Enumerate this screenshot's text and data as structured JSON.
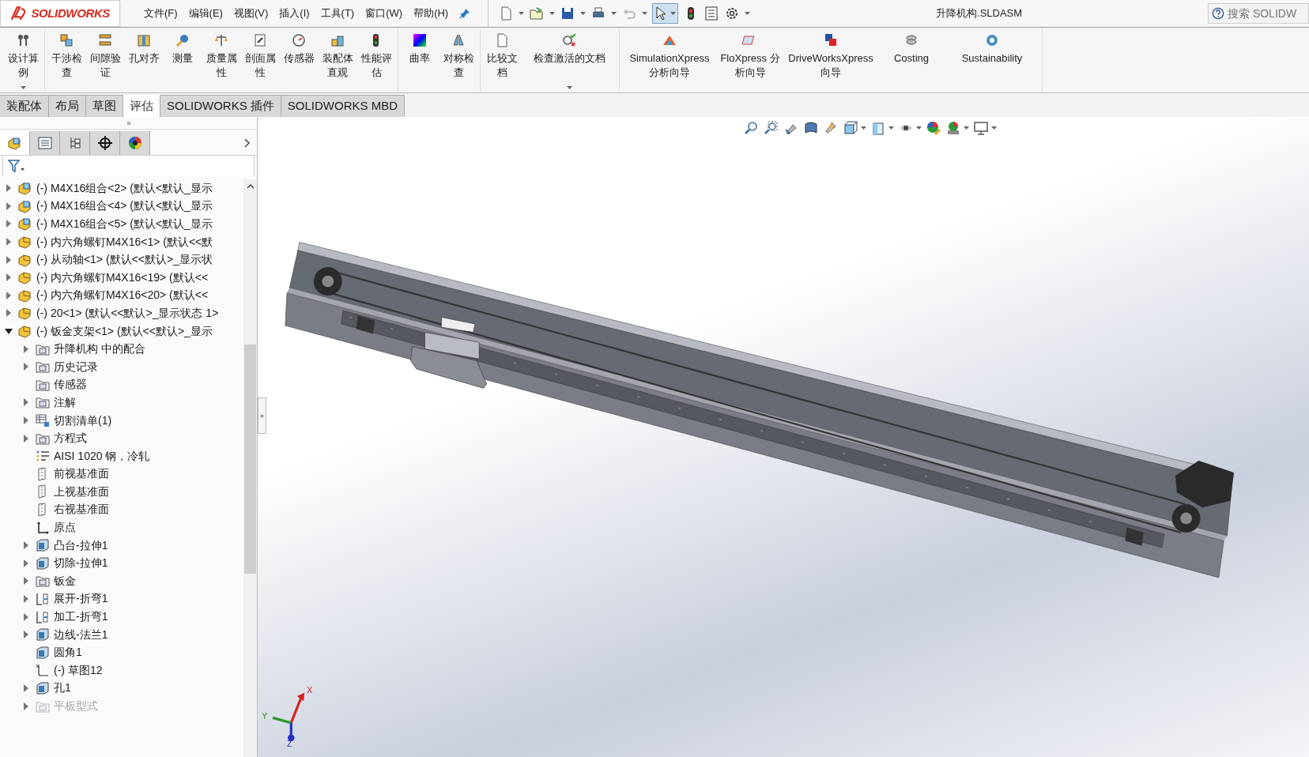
{
  "app": {
    "logo": "SOLIDWORKS"
  },
  "menu": [
    "文件(F)",
    "编辑(E)",
    "视图(V)",
    "插入(I)",
    "工具(T)",
    "窗口(W)",
    "帮助(H)"
  ],
  "window": {
    "title": "升降机构.SLDASM"
  },
  "search": {
    "placeholder": "搜索 SOLIDW"
  },
  "ribbon": {
    "groups": [
      [
        {
          "label": "设计算例",
          "kind": "narrow",
          "has_menu": true
        }
      ],
      [
        {
          "label": "干涉检查",
          "kind": "narrow",
          "has_menu": false
        },
        {
          "label": "间隙验证",
          "kind": "narrow",
          "has_menu": false
        },
        {
          "label": "孔对齐",
          "kind": "narrow",
          "has_menu": false
        },
        {
          "label": "测量",
          "kind": "narrow",
          "has_menu": false
        },
        {
          "label": "质量属性",
          "kind": "narrow",
          "has_menu": false
        },
        {
          "label": "剖面属性",
          "kind": "narrow",
          "has_menu": false
        },
        {
          "label": "传感器",
          "kind": "narrow",
          "has_menu": false
        },
        {
          "label": "装配体直观",
          "kind": "narrow",
          "has_menu": false
        },
        {
          "label": "性能评估",
          "kind": "narrow",
          "has_menu": false
        }
      ],
      [
        {
          "label": "曲率",
          "kind": "narrow",
          "has_menu": false
        },
        {
          "label": "对称检查",
          "kind": "narrow",
          "has_menu": false
        }
      ],
      [
        {
          "label": "比较文档",
          "kind": "narrow",
          "has_menu": false
        },
        {
          "label": "检查激活的文档",
          "kind": "wide",
          "has_menu": true
        }
      ],
      [
        {
          "label": "SimulationXpress 分析向导",
          "kind": "wide",
          "has_menu": false
        },
        {
          "label": "FloXpress 分析向导",
          "kind": "medium",
          "has_menu": false
        },
        {
          "label": "DriveWorksXpress 向导",
          "kind": "wide",
          "has_menu": false
        },
        {
          "label": "Costing",
          "kind": "medium",
          "has_menu": false
        },
        {
          "label": "Sustainability",
          "kind": "wide",
          "has_menu": false
        }
      ]
    ]
  },
  "tabs": [
    {
      "label": "装配体",
      "selected": false
    },
    {
      "label": "布局",
      "selected": false
    },
    {
      "label": "草图",
      "selected": false
    },
    {
      "label": "评估",
      "selected": true
    },
    {
      "label": "SOLIDWORKS 插件",
      "selected": false
    },
    {
      "label": "SOLIDWORKS MBD",
      "selected": false
    }
  ],
  "feature_manager": {
    "panel_tabs": [
      {
        "selected": true
      },
      {
        "selected": false
      },
      {
        "selected": false
      },
      {
        "selected": false
      },
      {
        "selected": false
      }
    ],
    "tree": [
      {
        "label": "(-) M4X16组合<2> (默认<默认_显示",
        "kind": "assembly",
        "expanded": false,
        "disabled": false
      },
      {
        "label": "(-) M4X16组合<4> (默认<默认_显示",
        "kind": "assembly",
        "expanded": false,
        "disabled": false
      },
      {
        "label": "(-) M4X16组合<5> (默认<默认_显示",
        "kind": "assembly",
        "expanded": false,
        "disabled": false
      },
      {
        "label": "(-) 内六角螺钉M4X16<1> (默认<<默",
        "kind": "part",
        "expanded": false,
        "disabled": false
      },
      {
        "label": "(-) 从动轴<1> (默认<<默认>_显示状",
        "kind": "part",
        "expanded": false,
        "disabled": false
      },
      {
        "label": "(-) 内六角螺钉M4X16<19> (默认<<",
        "kind": "part",
        "expanded": false,
        "disabled": false
      },
      {
        "label": "(-) 内六角螺钉M4X16<20> (默认<<",
        "kind": "part",
        "expanded": false,
        "disabled": false
      },
      {
        "label": "(-) 20<1> (默认<<默认>_显示状态 1>",
        "kind": "part",
        "expanded": false,
        "disabled": false
      },
      {
        "label": "(-) 钣金支架<1> (默认<<默认>_显示",
        "kind": "part",
        "expanded": true,
        "disabled": false,
        "children": [
          {
            "label": "升降机构 中的配合",
            "kind": "folder",
            "expanded": false,
            "disabled": false
          },
          {
            "label": "历史记录",
            "kind": "folder",
            "expanded": false,
            "disabled": false
          },
          {
            "label": "传感器",
            "kind": "folder",
            "disabled": false
          },
          {
            "label": "注解",
            "kind": "folder",
            "expanded": false,
            "disabled": false
          },
          {
            "label": "切割清单(1)",
            "kind": "cutlist",
            "expanded": false,
            "disabled": false
          },
          {
            "label": "方程式",
            "kind": "folder",
            "expanded": false,
            "disabled": false
          },
          {
            "label": "AISI 1020 钢，冷轧",
            "kind": "material",
            "disabled": false
          },
          {
            "label": "前视基准面",
            "kind": "plane",
            "disabled": false
          },
          {
            "label": "上视基准面",
            "kind": "plane",
            "disabled": false
          },
          {
            "label": "右视基准面",
            "kind": "plane",
            "disabled": false
          },
          {
            "label": "原点",
            "kind": "origin",
            "disabled": false
          },
          {
            "label": "凸台-拉伸1",
            "kind": "feature",
            "expanded": false,
            "disabled": false
          },
          {
            "label": "切除-拉伸1",
            "kind": "feature",
            "expanded": false,
            "disabled": false
          },
          {
            "label": "钣金",
            "kind": "folder",
            "expanded": false,
            "disabled": false
          },
          {
            "label": "展开-折弯1",
            "kind": "bend",
            "expanded": false,
            "disabled": false
          },
          {
            "label": "加工-折弯1",
            "kind": "bend",
            "expanded": false,
            "disabled": false
          },
          {
            "label": "边线-法兰1",
            "kind": "feature",
            "expanded": false,
            "disabled": false
          },
          {
            "label": "圆角1",
            "kind": "feature",
            "disabled": false
          },
          {
            "label": "(-) 草图12",
            "kind": "sketch",
            "disabled": false
          },
          {
            "label": "孔1",
            "kind": "feature",
            "expanded": false,
            "disabled": false
          },
          {
            "label": "平板型式",
            "kind": "folder",
            "expanded": false,
            "disabled": true
          }
        ]
      }
    ]
  },
  "viewport": {
    "triad": {
      "x": "X",
      "y": "Y",
      "z": "Z"
    }
  }
}
